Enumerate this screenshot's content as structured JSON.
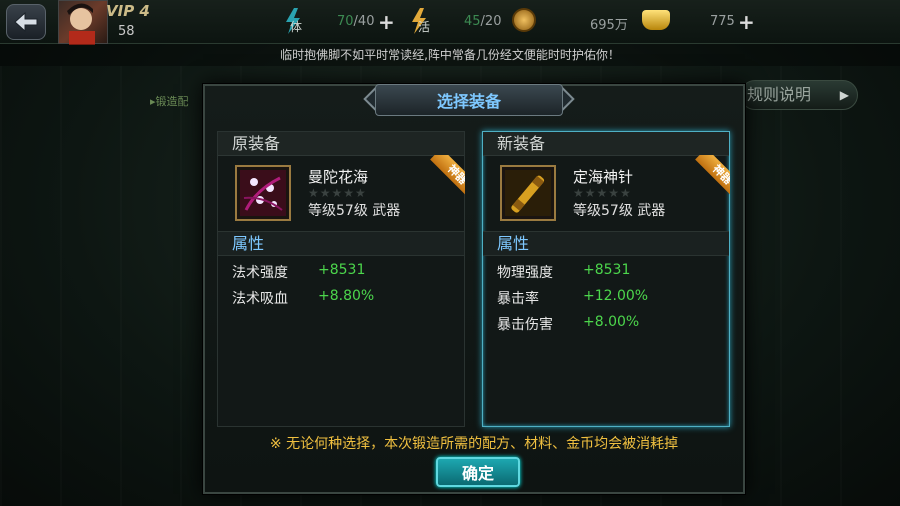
{
  "topbar": {
    "vip": "VIP 4",
    "level": "58",
    "stamina": {
      "label": "体",
      "current": "70",
      "max": "/40"
    },
    "vitality": {
      "label": "活",
      "current": "45",
      "max": "/20"
    },
    "copper": "695万",
    "gold": "775"
  },
  "notice": "临时抱佛脚不如平时常读经,阵中常备几份经文便能时时护佑你！",
  "background": {
    "hint": "▸锻造配",
    "rules_label": "规则说明"
  },
  "modal": {
    "title": "选择装备",
    "old": {
      "header": "原装备",
      "name": "曼陀花海",
      "level_text": "等级57级",
      "type_text": "武器",
      "badge": "神器",
      "attr_header": "属性",
      "attrs": [
        {
          "k": "法术强度",
          "v": "+8531"
        },
        {
          "k": "法术吸血",
          "v": "+8.80%"
        }
      ]
    },
    "new": {
      "header": "新装备",
      "name": "定海神针",
      "level_text": "等级57级",
      "type_text": "武器",
      "badge": "神器",
      "attr_header": "属性",
      "attrs": [
        {
          "k": "物理强度",
          "v": "+8531"
        },
        {
          "k": "暴击率",
          "v": "+12.00%"
        },
        {
          "k": "暴击伤害",
          "v": "+8.00%"
        }
      ]
    },
    "footer_note": "※ 无论何种选择，本次锻造所需的配方、材料、金币均会被消耗掉",
    "confirm_label": "确定"
  },
  "colors": {
    "accent_blue": "#7ec8ff",
    "value_green": "#4cd64c",
    "note_gold": "#f0c040",
    "button_teal": "#1da7b0"
  }
}
